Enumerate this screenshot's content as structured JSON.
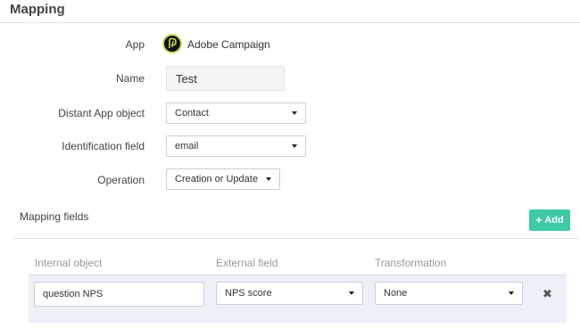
{
  "header": {
    "title": "Mapping"
  },
  "form": {
    "app_label": "App",
    "app_name": "Adobe Campaign",
    "name_label": "Name",
    "name_value": "Test",
    "distant_label": "Distant App object",
    "distant_value": "Contact",
    "ident_label": "Identification field",
    "ident_value": "email",
    "operation_label": "Operation",
    "operation_value": "Creation or Update"
  },
  "mapping": {
    "section_label": "Mapping fields",
    "add_label": "Add",
    "columns": [
      "Internal object",
      "External field",
      "Transformation"
    ],
    "rows": [
      {
        "internal": "question NPS",
        "external": "NPS score",
        "transformation": "None"
      }
    ]
  },
  "colors": {
    "accent": "#3ec9a7",
    "row_background": "#eef0f8"
  },
  "icons": {
    "app_logo": "adobe-campaign-logo-icon",
    "add": "plus-icon",
    "dropdown": "caret-down-icon",
    "remove": "close-icon"
  }
}
